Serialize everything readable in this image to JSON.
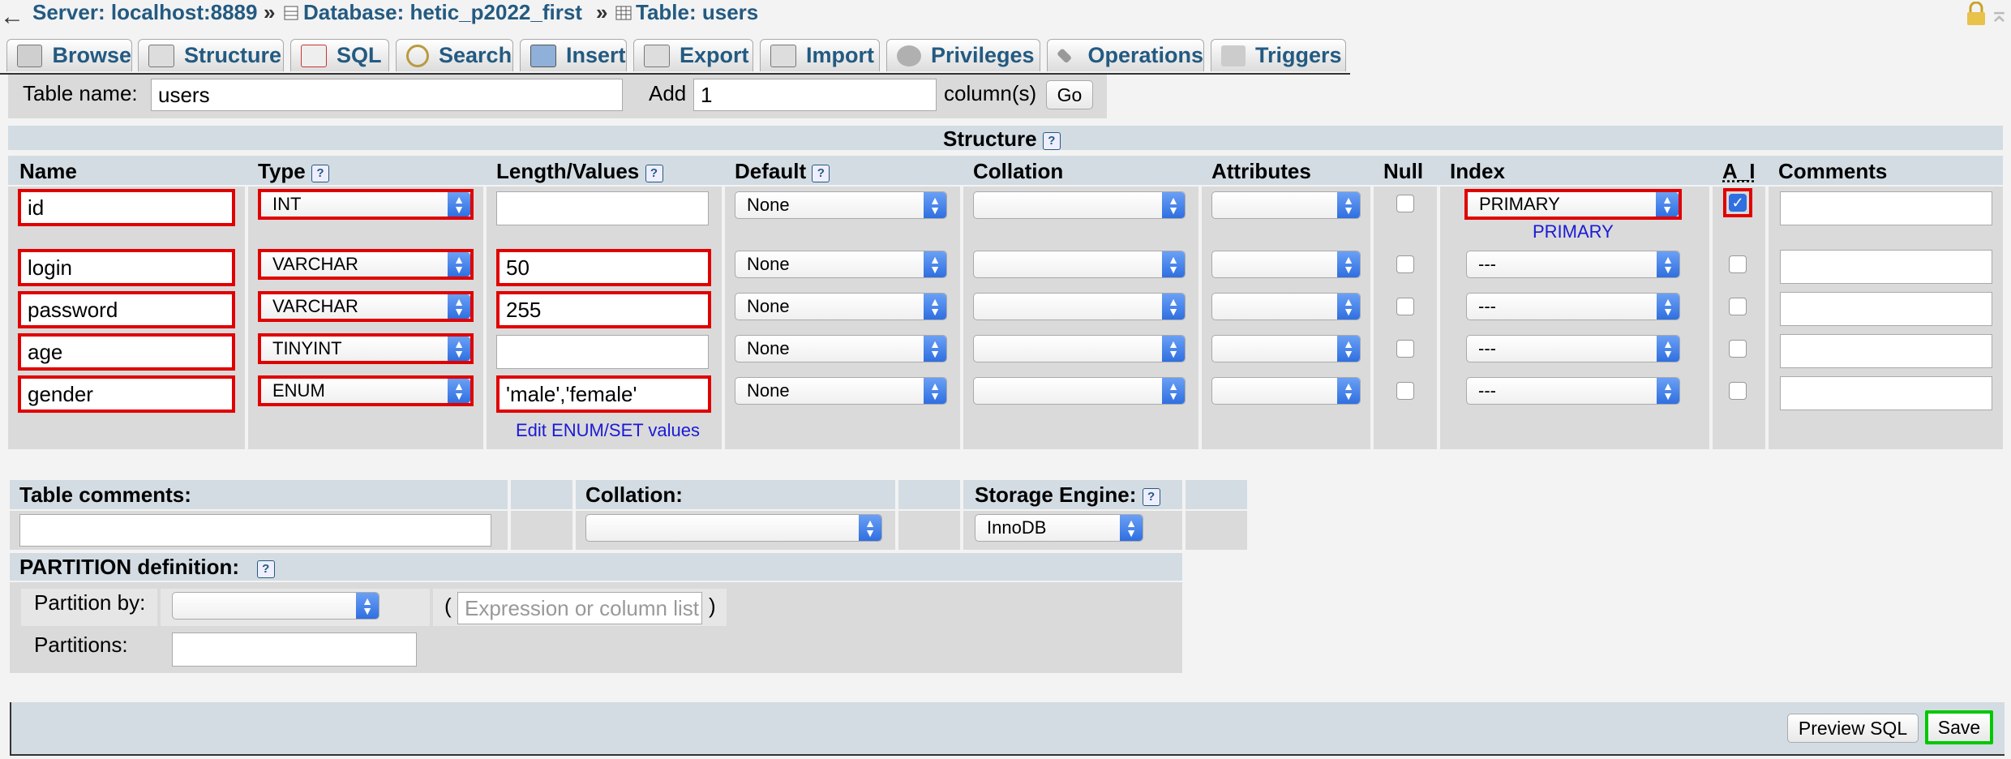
{
  "breadcrumb": {
    "back": "←",
    "server": "Server: localhost:8889",
    "database": "Database: hetic_p2022_first",
    "table": "Table: users",
    "sep": "»"
  },
  "tabs": [
    "Browse",
    "Structure",
    "SQL",
    "Search",
    "Insert",
    "Export",
    "Import",
    "Privileges",
    "Operations",
    "Triggers"
  ],
  "form": {
    "table_name_label": "Table name:",
    "table_name_value": "users",
    "add_label": "Add",
    "add_value": "1",
    "columns_label": "column(s)",
    "go_label": "Go"
  },
  "structure": {
    "title": "Structure",
    "headers": {
      "name": "Name",
      "type": "Type",
      "length": "Length/Values",
      "default": "Default",
      "collation": "Collation",
      "attributes": "Attributes",
      "null": "Null",
      "index": "Index",
      "ai": "A_I",
      "comments": "Comments"
    },
    "rows": [
      {
        "name": "id",
        "type": "INT",
        "length": "",
        "default": "None",
        "index": "PRIMARY",
        "ai": true
      },
      {
        "name": "login",
        "type": "VARCHAR",
        "length": "50",
        "default": "None",
        "index": "---",
        "ai": false
      },
      {
        "name": "password",
        "type": "VARCHAR",
        "length": "255",
        "default": "None",
        "index": "---",
        "ai": false
      },
      {
        "name": "age",
        "type": "TINYINT",
        "length": "",
        "default": "None",
        "index": "---",
        "ai": false
      },
      {
        "name": "gender",
        "type": "ENUM",
        "length": "'male','female'",
        "default": "None",
        "index": "---",
        "ai": false
      }
    ],
    "primary_link": "PRIMARY",
    "edit_enum_link": "Edit ENUM/SET values"
  },
  "table_options": {
    "comments_label": "Table comments:",
    "collation_label": "Collation:",
    "engine_label": "Storage Engine:",
    "engine_value": "InnoDB"
  },
  "partition": {
    "title": "PARTITION definition:",
    "by_label": "Partition by:",
    "open_paren": "(",
    "close_paren": ")",
    "expression_placeholder": "Expression or column list",
    "partitions_label": "Partitions:"
  },
  "footer": {
    "preview_label": "Preview SQL",
    "save_label": "Save"
  },
  "help_glyph": "?",
  "colors": {
    "link": "#235a81",
    "highlight": "#e00000",
    "save_border": "#00c800",
    "header_band": "#d3dce3"
  }
}
